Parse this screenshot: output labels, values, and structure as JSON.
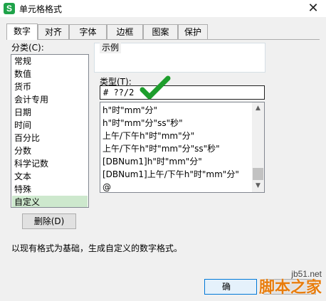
{
  "window": {
    "title": "单元格格式",
    "app_icon_letter": "S",
    "close_glyph": "✕"
  },
  "tabs": [
    {
      "label": "数字",
      "active": true
    },
    {
      "label": "对齐",
      "active": false
    },
    {
      "label": "字体",
      "active": false
    },
    {
      "label": "边框",
      "active": false
    },
    {
      "label": "图案",
      "active": false
    },
    {
      "label": "保护",
      "active": false
    }
  ],
  "category": {
    "label": "分类(C):",
    "items": [
      "常规",
      "数值",
      "货币",
      "会计专用",
      "日期",
      "时间",
      "百分比",
      "分数",
      "科学记数",
      "文本",
      "特殊",
      "自定义"
    ],
    "selected": "自定义"
  },
  "delete_button": "删除(D)",
  "sample": {
    "label": "示例",
    "value": ""
  },
  "type": {
    "label": "类型(T):",
    "value": "# ??/2",
    "list": [
      "h\"时\"mm\"分\"",
      "h\"时\"mm\"分\"ss\"秒\"",
      "上午/下午h\"时\"mm\"分\"",
      "上午/下午h\"时\"mm\"分\"ss\"秒\"",
      "[DBNum1]h\"时\"mm\"分\"",
      "[DBNum1]上午/下午h\"时\"mm\"分\"",
      "@"
    ]
  },
  "description": "以现有格式为基础，生成自定义的数字格式。",
  "buttons": {
    "ok": "确",
    "cancel": ""
  },
  "watermark": {
    "url": "jb51.net",
    "brand": "脚本之家"
  },
  "colors": {
    "check": "#1e9e2d",
    "selection": "#cde8cd",
    "watermark": "#e87d0d"
  }
}
